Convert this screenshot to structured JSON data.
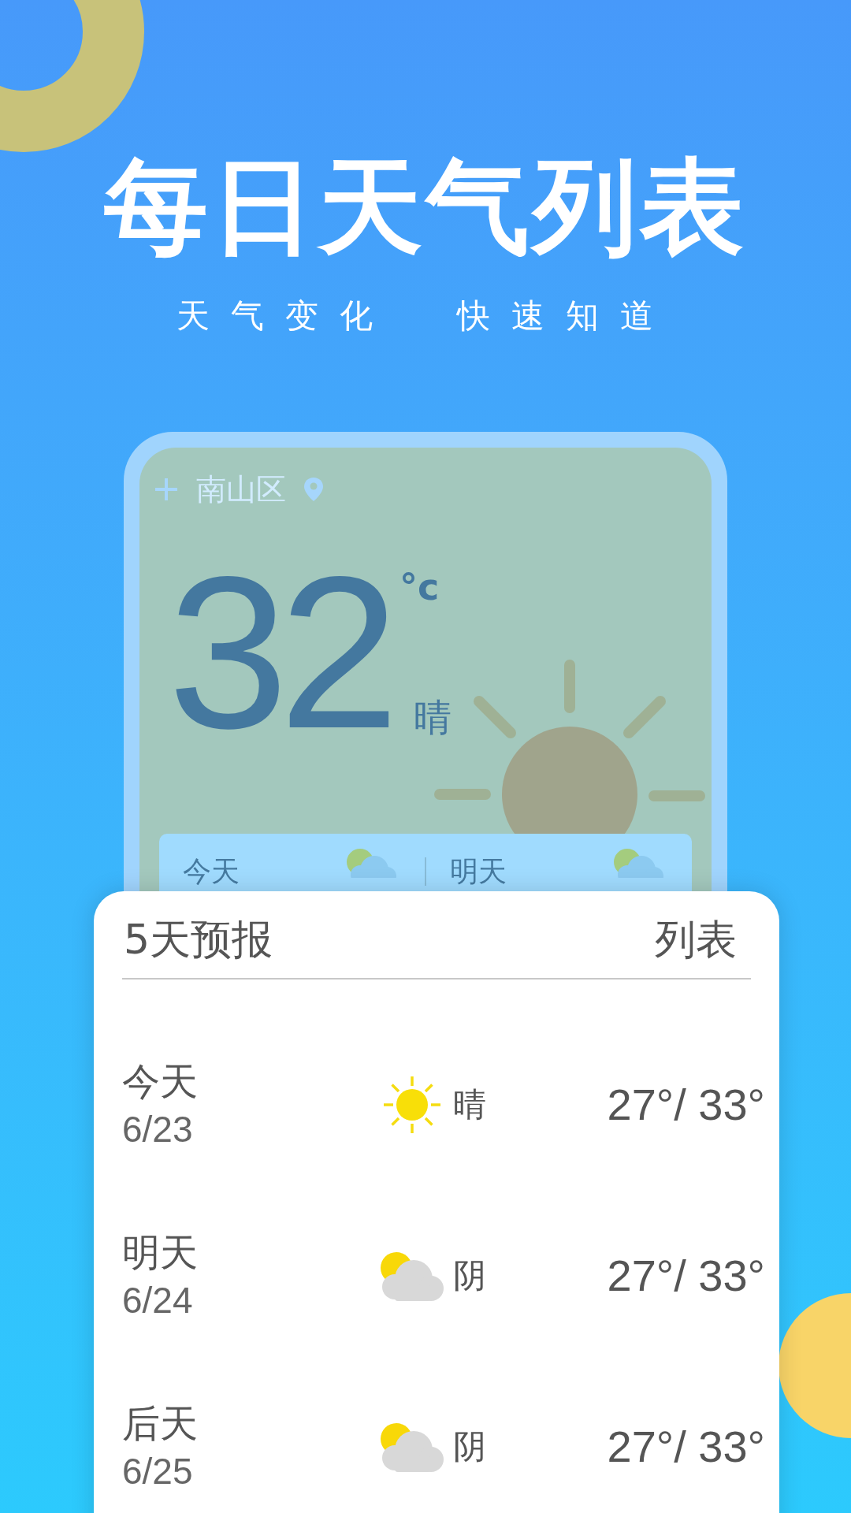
{
  "headline": "每日天气列表",
  "subtitle": "天气变化  快速知道",
  "phone": {
    "location": "南山区",
    "temperature": "32",
    "unit": "°c",
    "condition": "晴",
    "mini_forecast": [
      {
        "day": "今天",
        "kind": "partly_cloudy"
      },
      {
        "day": "明天",
        "kind": "partly_cloudy"
      }
    ]
  },
  "forecast": {
    "title": "5天预报",
    "view": "列表",
    "rows": [
      {
        "day": "今天",
        "date": "6/23",
        "kind": "sunny",
        "condition": "晴",
        "temp": "27°/ 33°"
      },
      {
        "day": "明天",
        "date": "6/24",
        "kind": "partly_cloudy",
        "condition": "阴",
        "temp": "27°/ 33°"
      },
      {
        "day": "后天",
        "date": "6/25",
        "kind": "partly_cloudy",
        "condition": "阴",
        "temp": "27°/ 33°"
      }
    ]
  }
}
